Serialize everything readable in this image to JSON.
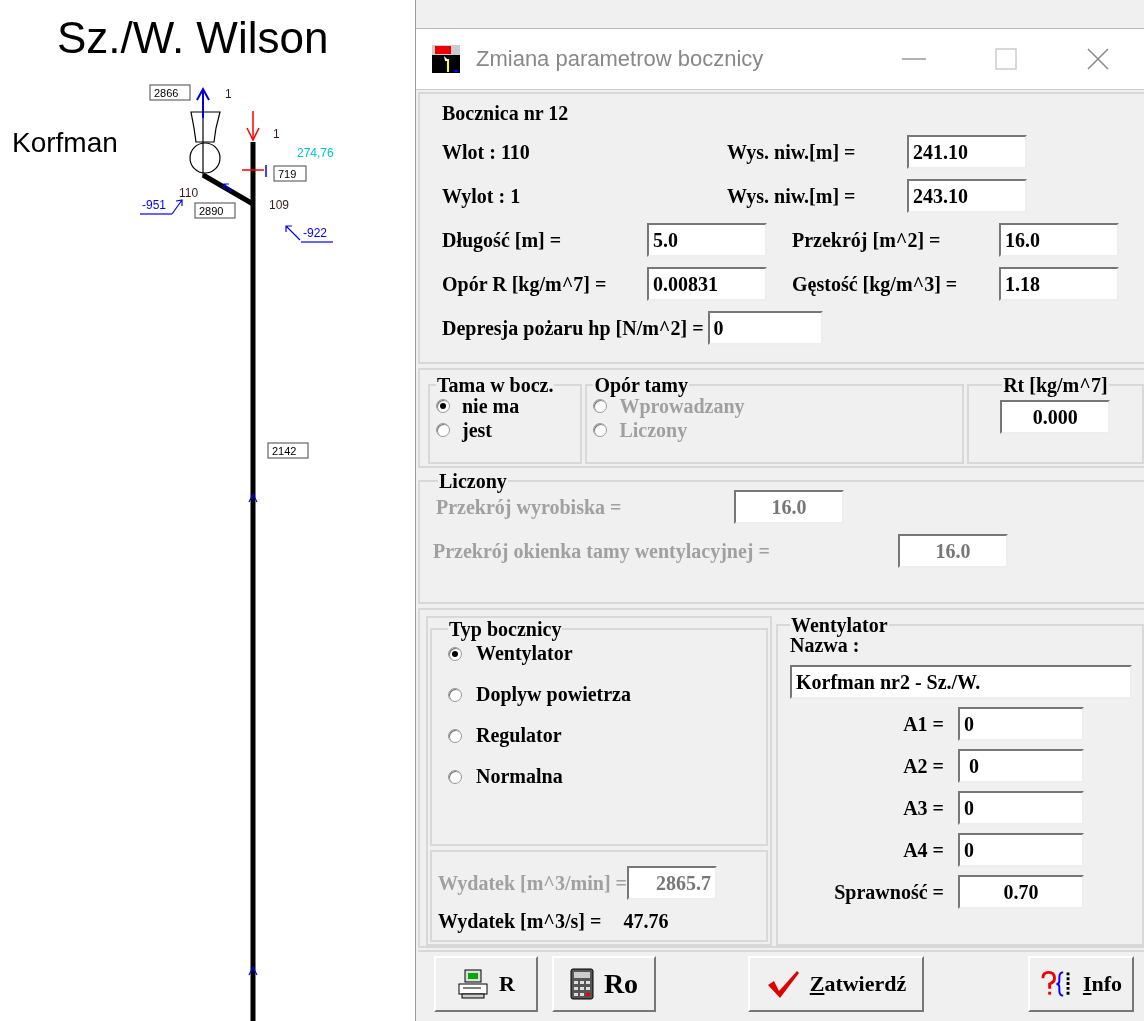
{
  "canvas": {
    "title": "Sz./W. Wilson",
    "site_label": "Korfman",
    "labels": [
      {
        "text": "2866",
        "kind": "boxed"
      },
      {
        "text": "1",
        "kind": "plain",
        "color": "#3a1a1a"
      },
      {
        "text": "1",
        "kind": "plain",
        "color": "#3a1a1a"
      },
      {
        "text": "274,76",
        "kind": "plain",
        "color": "#00c4dc"
      },
      {
        "text": "719",
        "kind": "boxed"
      },
      {
        "text": "110",
        "kind": "plain",
        "color": "#3a1a1a"
      },
      {
        "text": "2890",
        "kind": "boxed"
      },
      {
        "text": "109",
        "kind": "plain",
        "color": "#3a1a1a"
      },
      {
        "text": "-951",
        "kind": "flow",
        "color": "#0000ff"
      },
      {
        "text": "-922",
        "kind": "flow",
        "color": "#0000ff"
      },
      {
        "text": "2142",
        "kind": "boxed"
      }
    ]
  },
  "window": {
    "title": "Zmiana parametrow bocznicy"
  },
  "header": "Bocznica nr 12",
  "ends": [
    {
      "label": "Wlot : 110",
      "height_label": "Wys. niw.[m] =",
      "value": "241.10"
    },
    {
      "label": "Wylot : 1",
      "height_label": "Wys. niw.[m] =",
      "value": "243.10"
    }
  ],
  "params": [
    {
      "label": "Długość [m] =",
      "value": "5.0"
    },
    {
      "label": "Przekrój [m^2] =",
      "value": "16.0"
    },
    {
      "label": "Opór R [kg/m^7] =",
      "value": "0.00831"
    },
    {
      "label": "Gęstość [kg/m^3] =",
      "value": "1.18"
    }
  ],
  "fire_depression": {
    "label": "Depresja pożaru hp [N/m^2] =",
    "value": "0"
  },
  "dam": {
    "title": "Tama w bocz.",
    "options": [
      {
        "label": "nie ma",
        "selected": true,
        "disabled": false
      },
      {
        "label": "jest",
        "selected": false,
        "disabled": false
      }
    ]
  },
  "dam_resistance": {
    "title": "Opór tamy",
    "options": [
      {
        "label": "Wprowadzany",
        "selected": false,
        "disabled": true
      },
      {
        "label": "Liczony",
        "selected": false,
        "disabled": true
      }
    ]
  },
  "rt": {
    "title": "Rt [kg/m^7]",
    "value": "0.000"
  },
  "computed": {
    "title": "Liczony",
    "rows": [
      {
        "label": "Przekrój wyrobiska =",
        "value": "16.0",
        "disabled": true
      },
      {
        "label": "Przekrój okienka tamy wentylacyjnej =",
        "value": "16.0",
        "disabled": true
      }
    ]
  },
  "branch_type": {
    "title": "Typ bocznicy",
    "options": [
      {
        "label": "Wentylator",
        "selected": true,
        "disabled": false
      },
      {
        "label": "Doplyw powietrza",
        "selected": false,
        "disabled": false
      },
      {
        "label": "Regulator",
        "selected": false,
        "disabled": false
      },
      {
        "label": "Normalna",
        "selected": false,
        "disabled": false
      }
    ]
  },
  "flow": {
    "min_label": "Wydatek [m^3/min] =",
    "min_value": "2865.7",
    "min_disabled": true,
    "sec_label": "Wydatek [m^3/s] =",
    "sec_value": "47.76"
  },
  "fan": {
    "title": "Wentylator",
    "name_label": "Nazwa :",
    "name": "Korfman nr2 - Sz./W.",
    "coefficients": [
      {
        "label": "A1 =",
        "value": "0"
      },
      {
        "label": "A2 =",
        "value": " 0"
      },
      {
        "label": "A3 =",
        "value": "0"
      },
      {
        "label": "A4 =",
        "value": "0"
      }
    ],
    "efficiency": {
      "label": "Sprawność =",
      "value": "0.70"
    }
  },
  "buttons": [
    {
      "label": "R"
    },
    {
      "label": "Ro"
    },
    {
      "label": "Zatwierdź"
    },
    {
      "label": "Info"
    }
  ]
}
